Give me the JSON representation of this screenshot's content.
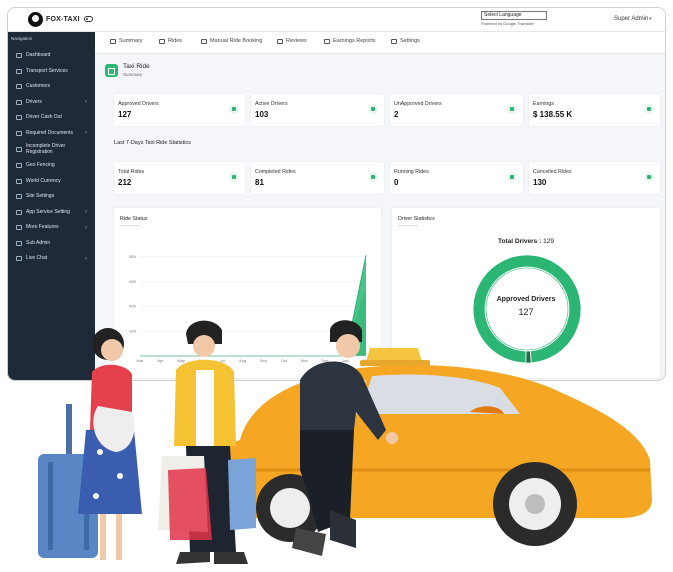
{
  "app": {
    "name": "FOX-TAXI"
  },
  "language": {
    "select_label": "Select Language",
    "powered_by": "Powered by Google Translate"
  },
  "user": {
    "name": "Super Admin"
  },
  "sidebar": {
    "heading": "Navigation",
    "items": [
      {
        "label": "Dashboard",
        "has_submenu": false
      },
      {
        "label": "Transport Services",
        "has_submenu": false
      },
      {
        "label": "Customers",
        "has_submenu": false
      },
      {
        "label": "Drivers",
        "has_submenu": true
      },
      {
        "label": "Driver Cash Out",
        "has_submenu": false
      },
      {
        "label": "Required Documents",
        "has_submenu": true
      },
      {
        "label": "Incomplete Driver Registration",
        "has_submenu": false
      },
      {
        "label": "Geo Fencing",
        "has_submenu": false
      },
      {
        "label": "World Currency",
        "has_submenu": false
      },
      {
        "label": "Site Settings",
        "has_submenu": false
      },
      {
        "label": "App Service Setting",
        "has_submenu": true
      },
      {
        "label": "More Features",
        "has_submenu": true
      },
      {
        "label": "Sub Admin",
        "has_submenu": false
      },
      {
        "label": "Live Chat",
        "has_submenu": true
      }
    ]
  },
  "tabs": [
    {
      "label": "Summary",
      "icon": "home-icon"
    },
    {
      "label": "Rides",
      "icon": "car-icon"
    },
    {
      "label": "Manual Ride Booking",
      "icon": "edit-icon"
    },
    {
      "label": "Reviews",
      "icon": "star-icon"
    },
    {
      "label": "Earnings Reports",
      "icon": "money-icon"
    },
    {
      "label": "Settings",
      "icon": "gear-icon"
    }
  ],
  "page": {
    "title": "Taxi Ride",
    "subtitle": "Summary"
  },
  "summary_cards": [
    {
      "label": "Approved Drivers",
      "value": "127",
      "icon": "user-check-icon"
    },
    {
      "label": "Active Drivers",
      "value": "103",
      "icon": "truck-icon"
    },
    {
      "label": "UnApproved Drivers",
      "value": "2",
      "icon": "user-plus-icon"
    },
    {
      "label": "Earnings",
      "value": "$ 138.55 K",
      "icon": "money-icon"
    }
  ],
  "stats_section": {
    "title": "Last 7-Days Taxi Ride Statistics"
  },
  "ride_cards": [
    {
      "label": "Total Rides",
      "value": "212",
      "icon": "car-icon"
    },
    {
      "label": "Completed Rides",
      "value": "81",
      "icon": "check-icon"
    },
    {
      "label": "Running Rides",
      "value": "0",
      "icon": "spinner-icon"
    },
    {
      "label": "Cancelled Rides",
      "value": "130",
      "icon": "close-icon"
    }
  ],
  "ride_status": {
    "title": "Ride Status"
  },
  "driver_statistics": {
    "title": "Driver Statistics",
    "total_label": "Total Drivers :",
    "total_value": "129",
    "center_label": "Approved Drivers",
    "center_value": "127"
  },
  "colors": {
    "accent": "#2bb673",
    "sidebar": "#1e2a38",
    "car": "#f5a623"
  },
  "chart_data": [
    {
      "type": "area",
      "title": "Ride Status",
      "categories": [
        "Mar",
        "Apr",
        "May",
        "Jun",
        "Jul",
        "Aug",
        "Sep",
        "Oct",
        "Nov",
        "Dec",
        "Jan",
        "Feb"
      ],
      "y_ticks": [
        "200",
        "400",
        "600",
        "800"
      ],
      "ylim": [
        0,
        900
      ],
      "series": [
        {
          "values": [
            0,
            0,
            0,
            0,
            0,
            0,
            0,
            0,
            0,
            0,
            0,
            810
          ],
          "color": "#2bb673"
        },
        {
          "values": [
            0,
            0,
            0,
            0,
            0,
            0,
            0,
            0,
            0,
            0,
            0,
            540
          ],
          "color": "#7fd4a8"
        }
      ]
    },
    {
      "type": "pie",
      "title": "Driver Statistics",
      "categories": [
        "Approved Drivers",
        "UnApproved Drivers"
      ],
      "values": [
        127,
        2
      ],
      "colors": [
        "#2bb673",
        "#1e6b46"
      ]
    }
  ]
}
